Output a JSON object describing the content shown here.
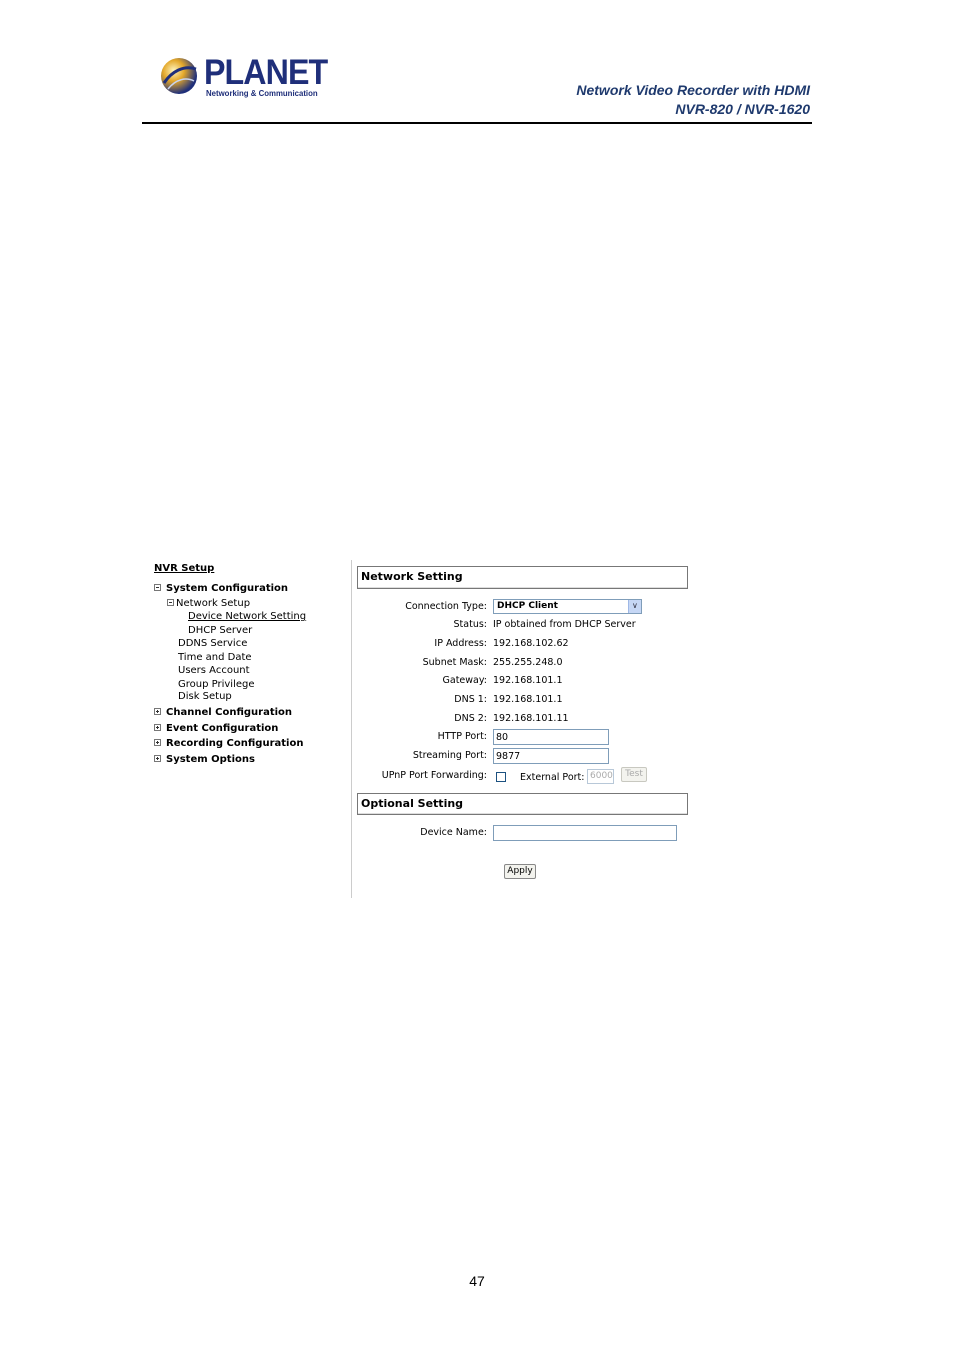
{
  "header": {
    "logo_word": "PLANET",
    "logo_tagline": "Networking & Communication",
    "title_line1": "Network Video Recorder with HDMI",
    "title_line2": "NVR-820 / NVR-1620",
    "brand_color": "#1f2f7a"
  },
  "sidebar": {
    "heading": "NVR Setup",
    "groups": [
      {
        "label": "System Configuration",
        "expanded": true,
        "children": [
          {
            "label": "Network Setup",
            "expanded": true,
            "children": [
              {
                "label": "Device Network Setting",
                "active": true
              },
              {
                "label": "DHCP Server"
              }
            ]
          },
          {
            "label": "DDNS Service"
          },
          {
            "label": "Time and Date"
          },
          {
            "label": "Users Account"
          },
          {
            "label": "Group Privilege"
          },
          {
            "label": "Disk Setup"
          }
        ]
      },
      {
        "label": "Channel Configuration",
        "expanded": false
      },
      {
        "label": "Event Configuration",
        "expanded": false
      },
      {
        "label": "Recording Configuration",
        "expanded": false
      },
      {
        "label": "System Options",
        "expanded": false
      }
    ]
  },
  "network_setting": {
    "title": "Network Setting",
    "connection_type": {
      "label": "Connection Type:",
      "value": "DHCP Client"
    },
    "status": {
      "label": "Status:",
      "value": "IP obtained from DHCP Server"
    },
    "ip_address": {
      "label": "IP Address:",
      "value": "192.168.102.62"
    },
    "subnet_mask": {
      "label": "Subnet Mask:",
      "value": "255.255.248.0"
    },
    "gateway": {
      "label": "Gateway:",
      "value": "192.168.101.1"
    },
    "dns1": {
      "label": "DNS 1:",
      "value": "192.168.101.1"
    },
    "dns2": {
      "label": "DNS 2:",
      "value": "192.168.101.11"
    },
    "http_port": {
      "label": "HTTP Port:",
      "value": "80"
    },
    "streaming_port": {
      "label": "Streaming Port:",
      "value": "9877"
    },
    "upnp": {
      "label": "UPnP Port Forwarding:",
      "checked": false,
      "external_port_label": "External Port:",
      "external_port_value": "6000",
      "test_label": "Test"
    }
  },
  "optional_setting": {
    "title": "Optional Setting",
    "device_name": {
      "label": "Device Name:",
      "value": ""
    },
    "apply_label": "Apply"
  },
  "footer": {
    "page_number": "47"
  }
}
